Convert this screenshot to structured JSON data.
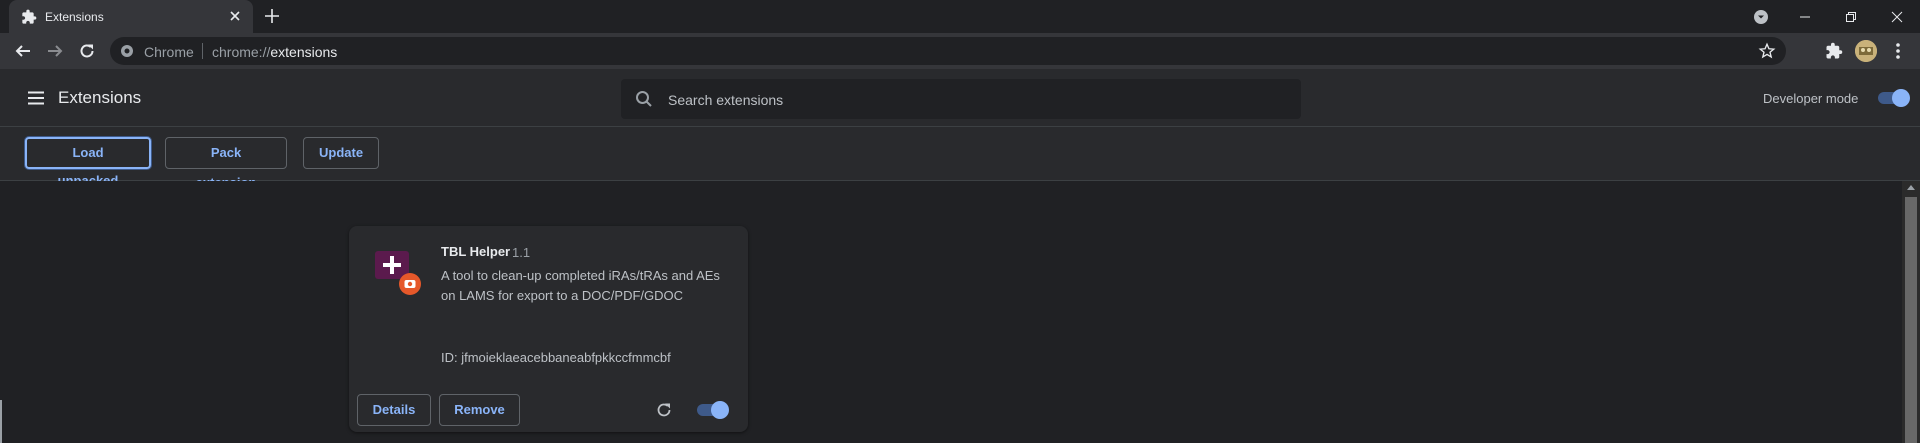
{
  "browser": {
    "tab": {
      "title": "Extensions",
      "icon": "puzzle-icon"
    },
    "omnibox": {
      "chip": "Chrome",
      "scheme": "chrome://",
      "host": "extensions"
    }
  },
  "header": {
    "title": "Extensions",
    "search_placeholder": "Search extensions",
    "developer_mode_label": "Developer mode",
    "developer_mode_on": true
  },
  "dev_toolbar": {
    "load_unpacked": "Load unpacked",
    "pack_extension": "Pack extension",
    "update": "Update"
  },
  "extension": {
    "name": "TBL Helper",
    "version": "1.1",
    "description": "A tool to clean-up completed iRAs/tRAs and AEs on LAMS for export to a DOC/PDF/GDOC",
    "id_text": "ID: jfmoieklaeacebbaneabfpkkccfmmcbf",
    "details_label": "Details",
    "remove_label": "Remove",
    "enabled": true
  },
  "colors": {
    "accent": "#8ab4f8",
    "background": "#202124",
    "surface": "#292a2d",
    "icon_purple": "#5b1a4d",
    "icon_badge": "#e5582a"
  }
}
